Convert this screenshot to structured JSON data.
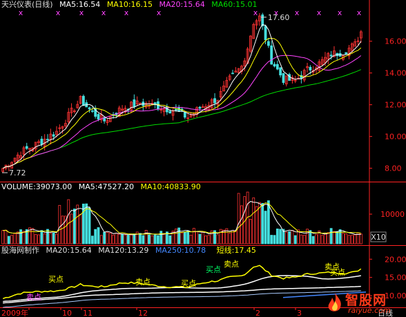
{
  "main": {
    "stock": "天兴仪表(日线)",
    "ma5": "MA5:16.54",
    "ma10": "MA10:16.15",
    "ma20": "MA20:15.64",
    "ma60": "MA60:15.01",
    "high_label": "17.60",
    "low_label": "7.72",
    "y_ticks": [
      "16.00",
      "14.00",
      "12.00",
      "10.00",
      "8.00"
    ],
    "markers": "x",
    "colors": {
      "ma5": "#ffffff",
      "ma10": "#ffff00",
      "ma20": "#ff44ff",
      "ma60": "#00dd00",
      "up": "#ff3333",
      "down": "#44dddd"
    }
  },
  "volume": {
    "volume": "VOLUME:39073.00",
    "ma5": "MA5:47527.20",
    "ma10": "MA10:40833.90",
    "y_tick": "10000",
    "unit": "X10"
  },
  "indicator": {
    "title": "股海网制作",
    "ma20": "MA20:15.64",
    "ma120": "MA120:13.29",
    "ma250": "MA250:10.78",
    "short": "短线:17.45",
    "y_ticks": [
      "20.00",
      "15.00",
      "10.00"
    ],
    "signals": [
      "卖点",
      "买点",
      "卖点",
      "买点",
      "买点",
      "卖点",
      "买点",
      "卖点"
    ]
  },
  "xaxis": {
    "labels": [
      "2009年",
      "10",
      "11",
      "12",
      "2",
      "3"
    ],
    "unit": "日线"
  },
  "watermark": {
    "name": "智股网",
    "url": "raiyue.com"
  }
}
